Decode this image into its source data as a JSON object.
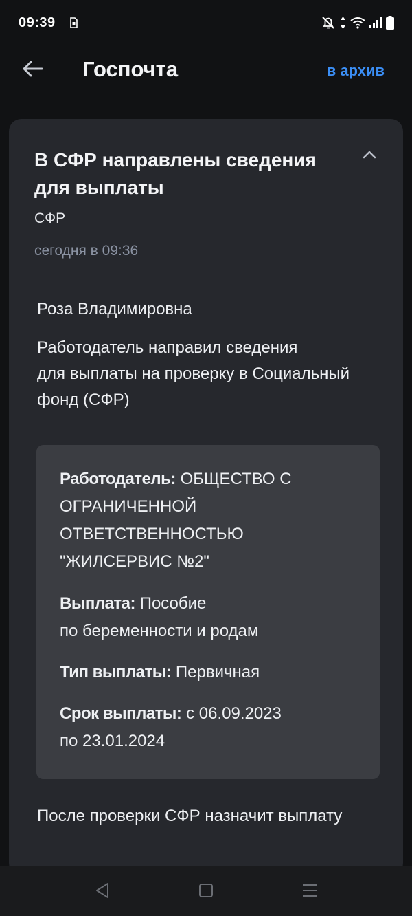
{
  "status_bar": {
    "time": "09:39"
  },
  "header": {
    "title": "Госпочта",
    "archive_label": "в архив"
  },
  "message": {
    "title": "В СФР направлены сведения для выплаты",
    "sender": "СФР",
    "date": "сегодня в 09:36",
    "greeting": "Роза Владимировна",
    "body_line1": "Работодатель направил сведения",
    "body_line2": "для выплаты на проверку в Социальный",
    "body_line3": "фонд (СФР)",
    "details": {
      "employer_label": "Работодатель:",
      "employer_value": "ОБЩЕСТВО С ОГРАНИЧЕННОЙ ОТВЕТСТВЕННОСТЬЮ \"ЖИЛСЕРВИС №2\"",
      "payment_label": "Выплата:",
      "payment_value_line1": "Пособие",
      "payment_value_line2": "по беременности и родам",
      "type_label": "Тип выплаты:",
      "type_value": "Первичная",
      "period_label": "Срок выплаты:",
      "period_value_line1": "с 06.09.2023",
      "period_value_line2": "по 23.01.2024"
    },
    "footer": "После проверки СФР назначит выплату"
  },
  "colors": {
    "accent": "#3b8ef5",
    "background": "#111214",
    "card": "#26282d",
    "info_box": "#3b3d42",
    "muted_text": "#8b93a3"
  },
  "icons": [
    "sim-card-icon",
    "mute-icon",
    "data-arrows-icon",
    "wifi-icon",
    "signal-icon",
    "battery-icon",
    "back-arrow-icon",
    "chevron-up-icon",
    "nav-back-icon",
    "nav-home-icon",
    "nav-recents-icon"
  ]
}
